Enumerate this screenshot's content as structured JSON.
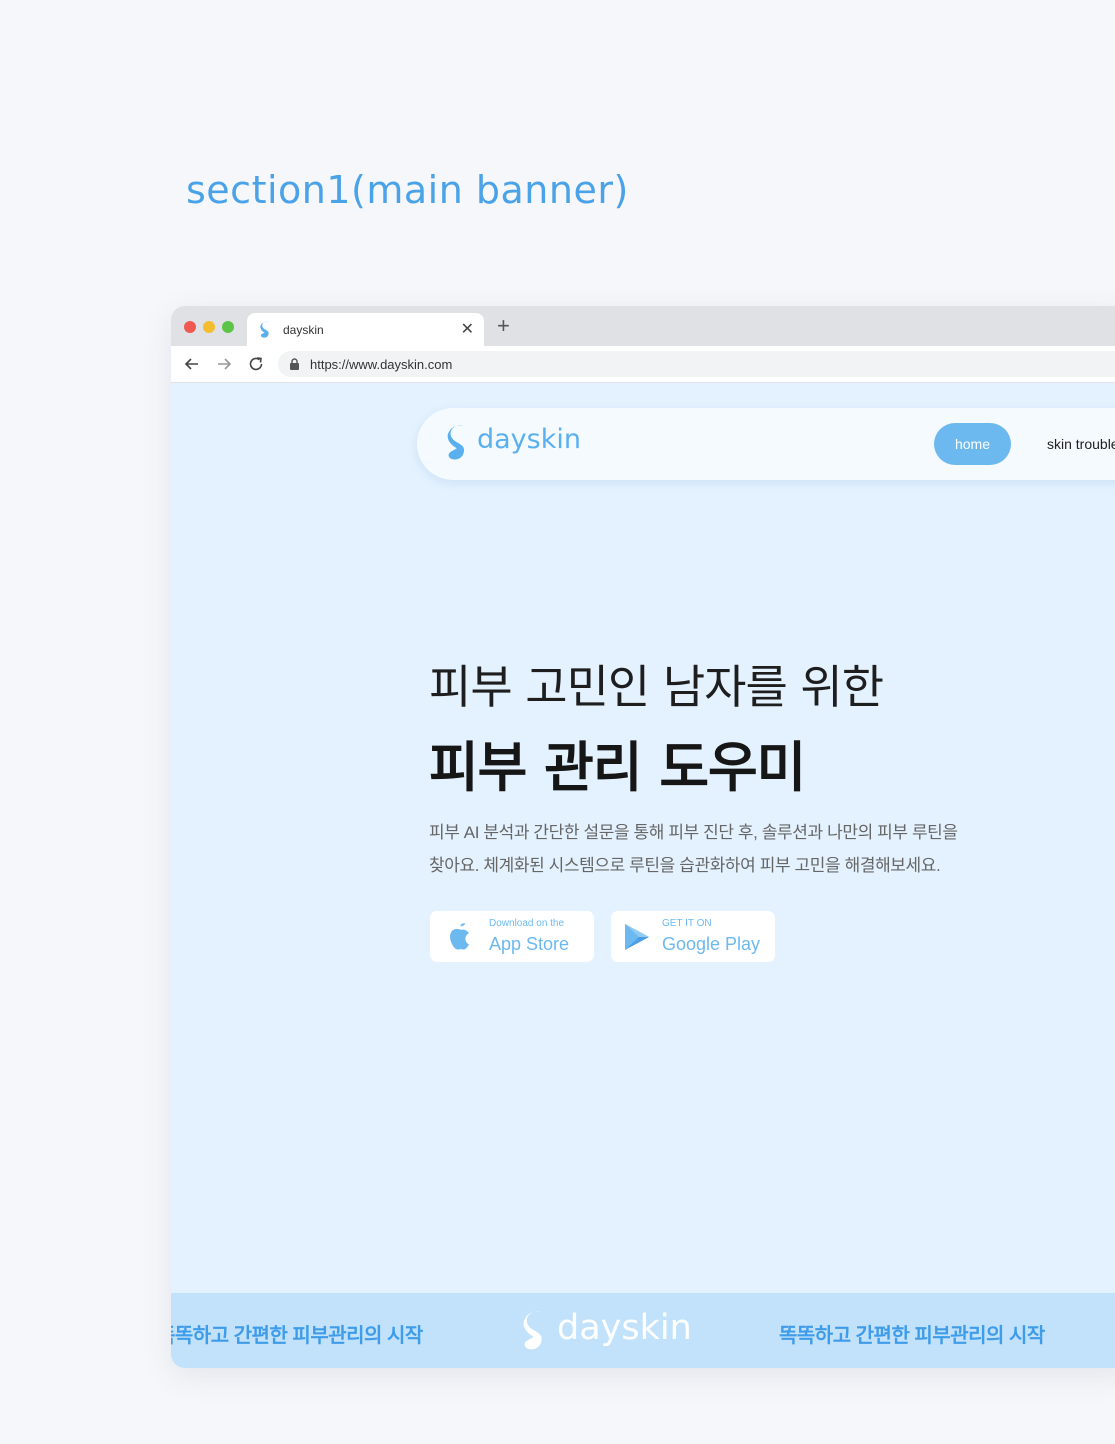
{
  "section_label": "section1(main banner)",
  "browser": {
    "tab_title": "dayskin",
    "url": "https://www.dayskin.com"
  },
  "nav": {
    "logo": "dayskin",
    "items": [
      "home",
      "skin trouble"
    ]
  },
  "hero": {
    "line1": "피부 고민인 남자를 위한",
    "line2": "피부 관리 도우미",
    "desc_line1": "피부 AI 분석과 간단한 설문을 통해 피부 진단 후, 솔루션과 나만의 피부 루틴을",
    "desc_line2": "찾아요. 체계화된 시스템으로 루틴을 습관화하여 피부 고민을 해결해보세요."
  },
  "stores": {
    "app_small": "Download on the",
    "app_big": "App Store",
    "gp_small": "GET IT ON",
    "gp_big": "Google Play"
  },
  "marquee": {
    "left": "똑똑하고 간편한 피부관리의 시작",
    "logo": "dayskin",
    "right": "똑똑하고 간편한 피부관리의 시작"
  },
  "colors": {
    "accent": "#5ab0ee",
    "page_bg": "#e4f2ff",
    "marquee_bg": "#c2e2fc"
  }
}
